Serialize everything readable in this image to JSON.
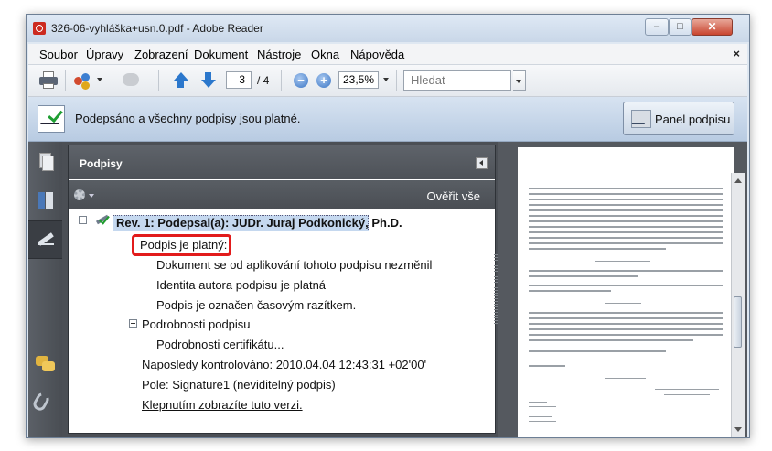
{
  "window": {
    "title": "326-06-vyhláška+usn.0.pdf - Adobe Reader",
    "min_symbol": "–",
    "max_symbol": "□",
    "close_symbol": "✕"
  },
  "menu": {
    "items": [
      "Soubor",
      "Úpravy",
      "Zobrazení",
      "Dokument",
      "Nástroje",
      "Okna",
      "Nápověda"
    ],
    "close_symbol": "×"
  },
  "toolbar": {
    "page_current": "3",
    "page_total": "/ 4",
    "zoom_out_symbol": "−",
    "zoom_in_symbol": "+",
    "zoom": "23,5%",
    "search_placeholder": "Hledat",
    "icons": [
      "printer-icon",
      "share-icon",
      "chat-icon",
      "arrow-up-icon",
      "arrow-down-icon",
      "zoom-out-icon",
      "zoom-in-icon"
    ]
  },
  "sigbar": {
    "message": "Podepsáno a všechny podpisy jsou platné.",
    "panel_button": "Panel podpisu"
  },
  "nav": {
    "icons": [
      "pages-icon",
      "bookmarks-icon",
      "signature-icon",
      "comments-icon",
      "attachments-icon"
    ]
  },
  "sigpanel": {
    "title": "Podpisy",
    "verify_all": "Ověřit vše",
    "tree": {
      "revision": "Rev. 1: Podepsal(a): JUDr. Juraj Podkonický, Ph.D.",
      "valid_label": "Podpis je platný:",
      "valid_items": [
        "Dokument se od aplikování tohoto podpisu nezměnil",
        "Identita autora podpisu je platná",
        "Podpis je označen časovým razítkem."
      ],
      "details_label": "Podrobnosti podpisu",
      "cert_details": "Podrobnosti certifikátu...",
      "last_checked": "Naposledy kontrolováno: 2010.04.04 12:43:31 +02'00'",
      "field": "Pole: Signature1 (neviditelný podpis)",
      "view_link": "Klepnutím zobrazíte tuto verzi."
    }
  },
  "colors": {
    "highlight_border": "#e21b1b",
    "selection": "#c5d8ef",
    "valid_check": "#1f9c2e"
  }
}
